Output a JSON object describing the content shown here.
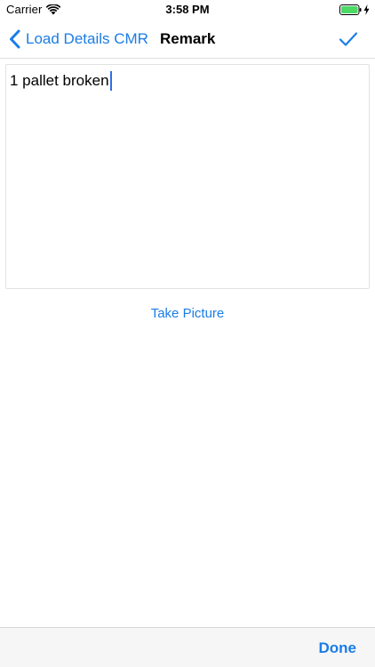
{
  "status_bar": {
    "carrier": "Carrier",
    "time": "3:58 PM",
    "icons": [
      "wifi-icon",
      "battery-icon",
      "charging-icon"
    ],
    "battery_color": "#4cd964"
  },
  "nav_bar": {
    "back_label": "Load Details CMR",
    "title": "Remark",
    "confirm_icon": "checkmark-icon",
    "accent_color": "#1a7de6"
  },
  "remark": {
    "value": "1 pallet broken"
  },
  "actions": {
    "take_picture_label": "Take Picture"
  },
  "accessory_bar": {
    "done_label": "Done"
  }
}
